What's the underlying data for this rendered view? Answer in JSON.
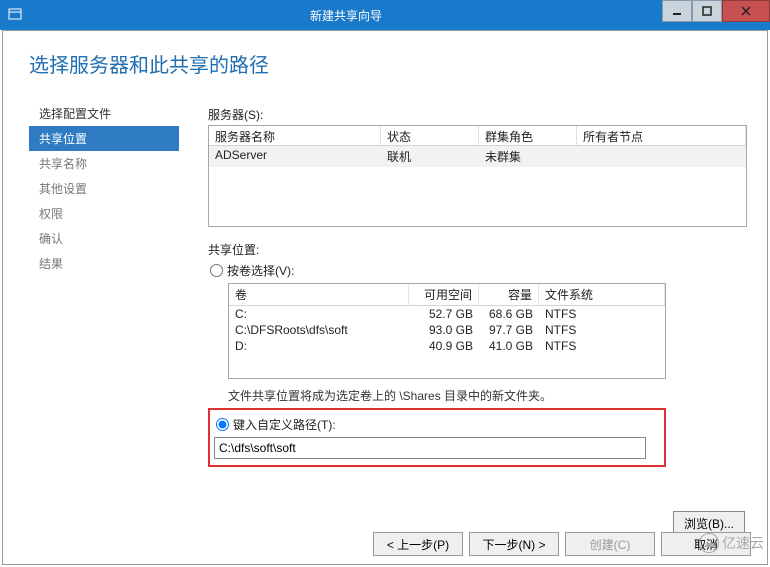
{
  "titlebar": {
    "title": "新建共享向导"
  },
  "header": {
    "title": "选择服务器和此共享的路径"
  },
  "nav": {
    "items": [
      "选择配置文件",
      "共享位置",
      "共享名称",
      "其他设置",
      "权限",
      "确认",
      "结果"
    ]
  },
  "servers": {
    "label": "服务器(S):",
    "columns": {
      "name": "服务器名称",
      "status": "状态",
      "role": "群集角色",
      "owner": "所有者节点"
    },
    "rows": [
      {
        "name": "ADServer",
        "status": "联机",
        "role": "未群集",
        "owner": ""
      }
    ]
  },
  "shareLocation": {
    "label": "共享位置:",
    "byVolume": "按卷选择(V):",
    "customPath": "键入自定义路径(T):",
    "pathValue": "C:\\dfs\\soft\\soft",
    "browse": "浏览(B)..."
  },
  "volumes": {
    "columns": {
      "vol": "卷",
      "free": "可用空间",
      "cap": "容量",
      "fs": "文件系统"
    },
    "rows": [
      {
        "vol": "C:",
        "free": "52.7 GB",
        "cap": "68.6 GB",
        "fs": "NTFS"
      },
      {
        "vol": "C:\\DFSRoots\\dfs\\soft",
        "free": "93.0 GB",
        "cap": "97.7 GB",
        "fs": "NTFS"
      },
      {
        "vol": "D:",
        "free": "40.9 GB",
        "cap": "41.0 GB",
        "fs": "NTFS"
      }
    ]
  },
  "note": "文件共享位置将成为选定卷上的 \\Shares 目录中的新文件夹。",
  "footer": {
    "prev": "< 上一步(P)",
    "next": "下一步(N) >",
    "create": "创建(C)",
    "cancel": "取消"
  },
  "watermark": "亿速云"
}
